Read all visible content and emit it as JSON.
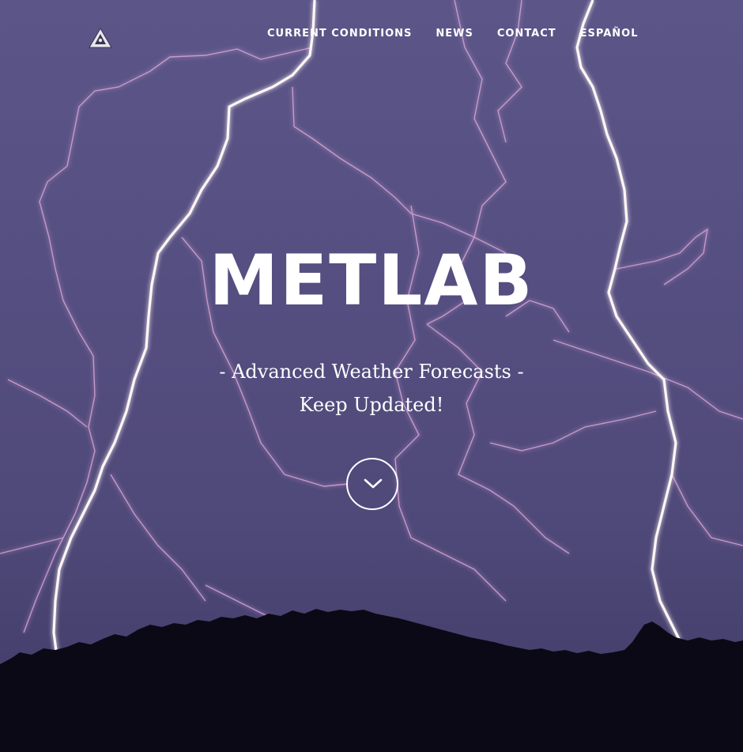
{
  "header": {
    "logo_icon": "triangle-logo-icon",
    "nav": [
      {
        "label": "CURRENT CONDITIONS"
      },
      {
        "label": "NEWS"
      },
      {
        "label": "CONTACT"
      },
      {
        "label": "ESPAÑOL"
      }
    ]
  },
  "hero": {
    "title": "METLAB",
    "tagline_line1": "- Advanced Weather Forecasts -",
    "tagline_line2": "Keep Updated!",
    "scroll_icon": "chevron-down-icon"
  },
  "colors": {
    "sky_top": "#5c5688",
    "sky_bottom": "#403a66",
    "lightning": "#fff3f3",
    "lightning_glow": "#e49ad0",
    "treeline": "#0b0916",
    "text": "#ffffff"
  }
}
